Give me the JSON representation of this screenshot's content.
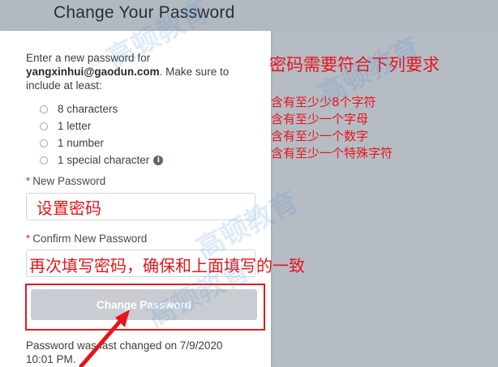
{
  "page": {
    "title": "Change Your Password"
  },
  "form": {
    "instructions_prefix": "Enter a new password for",
    "email": "yangxinhui@gaodun.com",
    "instructions_suffix": ". Make sure to include at least:",
    "requirements": [
      "8 characters",
      "1 letter",
      "1 number",
      "1 special character"
    ],
    "new_password_label": "New Password",
    "new_password_value": "设置密码",
    "confirm_password_label": "Confirm New Password",
    "confirm_password_value": "",
    "required_marker": "*",
    "submit_label": "Change Password",
    "last_changed": "Password was last changed on 7/9/2020 10:01 PM."
  },
  "annotations": {
    "title": "密码需要符合下列要求",
    "items": [
      "含有至少少8个字符",
      "含有至少一个字母",
      "含有至少一个数字",
      "含有至少一个特殊字符"
    ],
    "confirm_note": "再次填写密码，确保和上面填写的一致"
  },
  "watermark": {
    "text": "高顿教育"
  },
  "colors": {
    "annotation": "#e8141a",
    "button_disabled": "#c9cdd3",
    "backdrop": "#b6bcc4"
  },
  "icons": {
    "info": "info-icon",
    "arrow": "arrow-annotation-icon"
  }
}
